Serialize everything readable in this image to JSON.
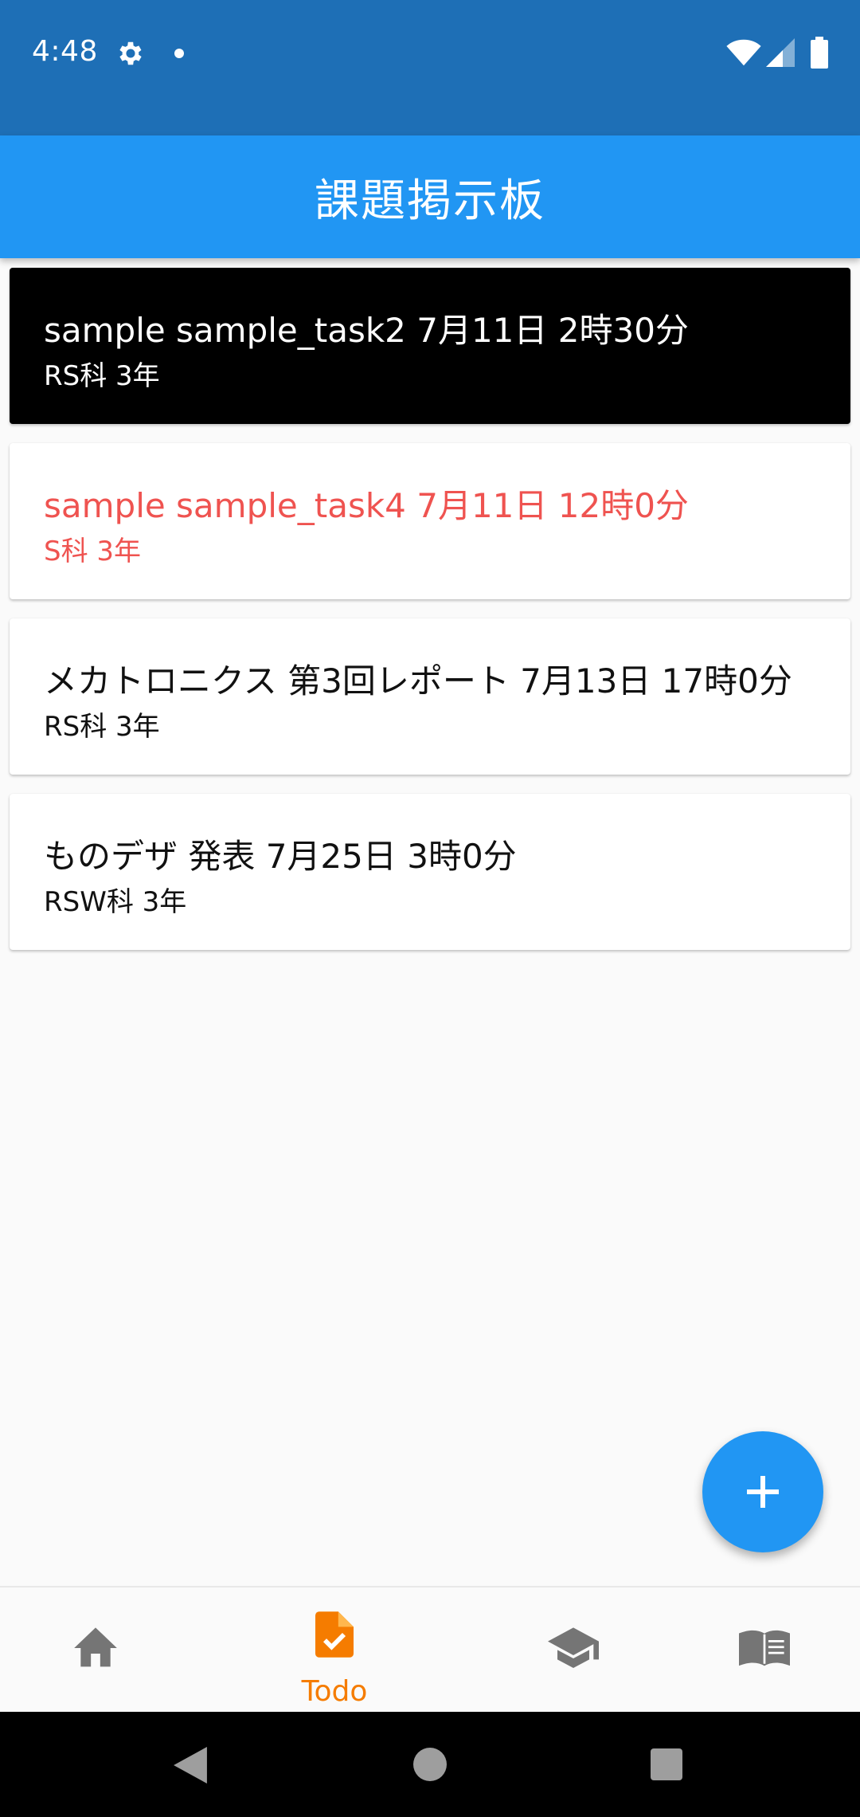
{
  "status_bar": {
    "time": "4:48",
    "background": "#1e6fb6",
    "icons": [
      "gear-icon",
      "notification-dot-icon",
      "wifi-icon",
      "signal-icon",
      "battery-icon"
    ]
  },
  "app_bar": {
    "title": "課題掲示板",
    "background": "#2196f3"
  },
  "tasks": [
    {
      "title": "sample sample_task2 7月11日 2時30分",
      "subtitle": "RS科 3年",
      "style": "black-background"
    },
    {
      "title": "sample sample_task4 7月11日 12時0分",
      "subtitle": "S科 3年",
      "style": "red-text"
    },
    {
      "title": "メカトロニクス 第3回レポート 7月13日 17時0分",
      "subtitle": "RS科 3年",
      "style": "normal"
    },
    {
      "title": "ものデザ 発表 7月25日 3時0分",
      "subtitle": "RSW科 3年",
      "style": "normal"
    }
  ],
  "colors": {
    "accent": "#2196f3",
    "alert_text": "#ef5350",
    "active_nav": "#f57c00",
    "inactive_nav": "#757575"
  },
  "fab": {
    "icon": "plus-icon"
  },
  "bottom_nav": {
    "items": [
      {
        "icon": "home-icon",
        "label": "",
        "active": false
      },
      {
        "icon": "todo-document-icon",
        "label": "Todo",
        "active": true
      },
      {
        "icon": "graduation-cap-icon",
        "label": "",
        "active": false
      },
      {
        "icon": "book-icon",
        "label": "",
        "active": false
      }
    ]
  },
  "system_nav": {
    "icons": [
      "back-icon",
      "home-circle-icon",
      "recents-icon"
    ]
  }
}
